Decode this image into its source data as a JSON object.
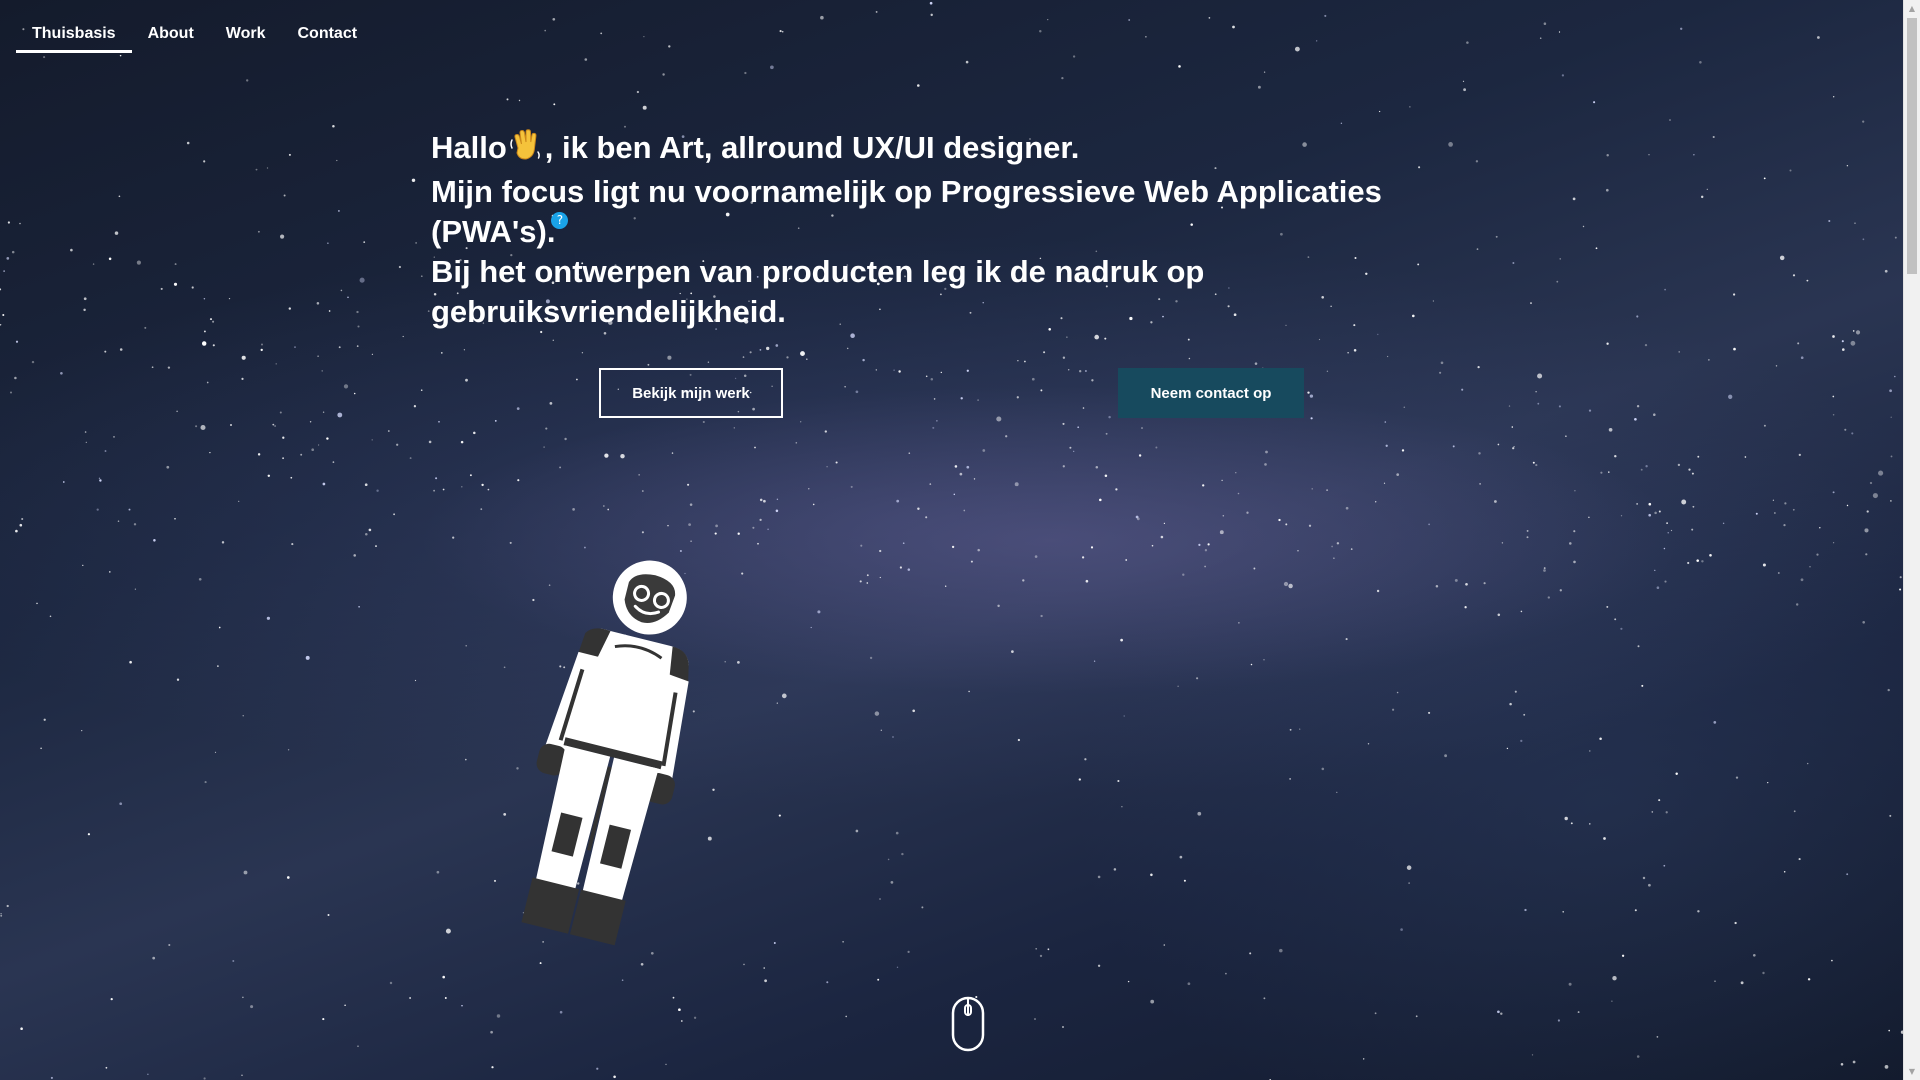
{
  "nav": {
    "items": [
      {
        "label": "Thuisbasis",
        "active": true
      },
      {
        "label": "About",
        "active": false
      },
      {
        "label": "Work",
        "active": false
      },
      {
        "label": "Contact",
        "active": false
      }
    ]
  },
  "hero": {
    "line1_before": "Hallo",
    "line1_after": ", ik ben Art, allround UX/UI designer.",
    "line2": "Mijn focus ligt nu voornamelijk op Progressieve Web Applicaties (PWA's).",
    "help_badge": "?",
    "line3": "Bij het ontwerpen van producten leg ik de nadruk op gebruiksvriendelijkheid."
  },
  "buttons": {
    "primary_label": "Bekijk mijn werk",
    "secondary_label": "Neem contact op"
  },
  "icons": {
    "wave": "waving-hand-icon",
    "astronaut": "astronaut-illustration",
    "mouse": "mouse-scroll-icon"
  },
  "colors": {
    "background": "#1c2740",
    "accent_button": "#174a5e",
    "help_badge": "#1aa3e8",
    "text": "#ffffff"
  }
}
